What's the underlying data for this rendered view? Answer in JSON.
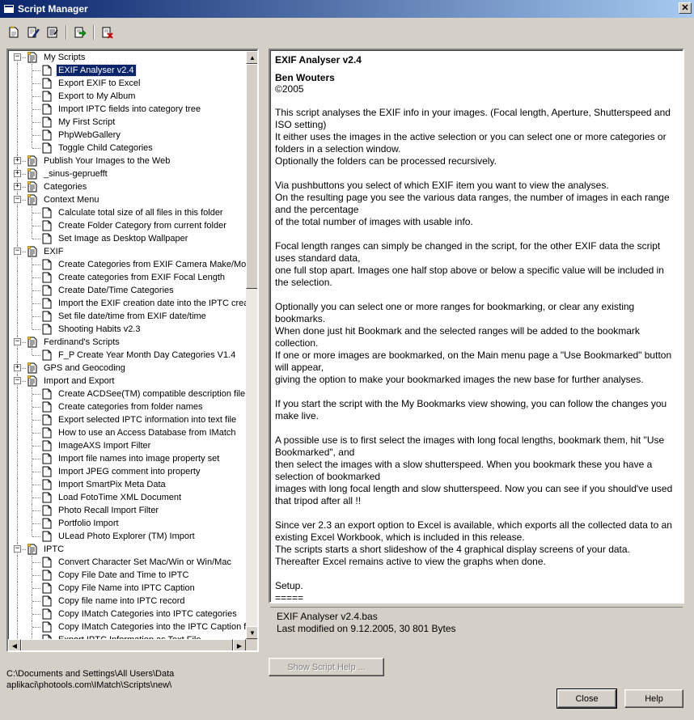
{
  "window": {
    "title": "Script Manager",
    "close_glyph": "✕"
  },
  "toolbar": [
    "new-script-icon",
    "edit-script-icon",
    "properties-icon",
    "run-script-icon",
    "delete-script-icon"
  ],
  "tree": {
    "rows": [
      {
        "label": "My Scripts",
        "level": 0,
        "type": "folder",
        "expander": "−"
      },
      {
        "label": "EXIF Analyser v2.4",
        "level": 1,
        "type": "script",
        "selected": true
      },
      {
        "label": "Export EXIF to Excel",
        "level": 1,
        "type": "script"
      },
      {
        "label": "Export to My Album",
        "level": 1,
        "type": "script"
      },
      {
        "label": "Import IPTC fields into category tree",
        "level": 1,
        "type": "script"
      },
      {
        "label": "My First Script",
        "level": 1,
        "type": "script"
      },
      {
        "label": "PhpWebGallery",
        "level": 1,
        "type": "script"
      },
      {
        "label": "Toggle Child Categories",
        "level": 1,
        "type": "script"
      },
      {
        "label": "Publish Your Images to the Web",
        "level": 0,
        "type": "folder",
        "expander": "+"
      },
      {
        "label": "_sinus-gepruefft",
        "level": 0,
        "type": "folder",
        "expander": "+"
      },
      {
        "label": "Categories",
        "level": 0,
        "type": "folder",
        "expander": "+"
      },
      {
        "label": "Context Menu",
        "level": 0,
        "type": "folder",
        "expander": "−"
      },
      {
        "label": "Calculate total size of all files in this folder",
        "level": 1,
        "type": "script"
      },
      {
        "label": "Create Folder Category from current folder",
        "level": 1,
        "type": "script"
      },
      {
        "label": "Set Image as Desktop Wallpaper",
        "level": 1,
        "type": "script"
      },
      {
        "label": "EXIF",
        "level": 0,
        "type": "folder",
        "expander": "−"
      },
      {
        "label": "Create Categories from EXIF Camera Make/Mod",
        "level": 1,
        "type": "script"
      },
      {
        "label": "Create categories from EXIF Focal Length",
        "level": 1,
        "type": "script"
      },
      {
        "label": "Create Date/Time Categories",
        "level": 1,
        "type": "script"
      },
      {
        "label": "Import the EXIF creation date into the IPTC crea",
        "level": 1,
        "type": "script"
      },
      {
        "label": "Set file date/time from EXIF date/time",
        "level": 1,
        "type": "script"
      },
      {
        "label": "Shooting Habits v2.3",
        "level": 1,
        "type": "script"
      },
      {
        "label": "Ferdinand's Scripts",
        "level": 0,
        "type": "folder",
        "expander": "−"
      },
      {
        "label": "F_P Create Year Month Day Categories V1.4",
        "level": 1,
        "type": "script"
      },
      {
        "label": "GPS and Geocoding",
        "level": 0,
        "type": "folder",
        "expander": "+"
      },
      {
        "label": "Import and Export",
        "level": 0,
        "type": "folder",
        "expander": "−"
      },
      {
        "label": "Create ACDSee(TM) compatible description file f",
        "level": 1,
        "type": "script"
      },
      {
        "label": "Create categories from folder names",
        "level": 1,
        "type": "script"
      },
      {
        "label": "Export selected IPTC information into text file",
        "level": 1,
        "type": "script"
      },
      {
        "label": "How to use an Access Database from IMatch",
        "level": 1,
        "type": "script"
      },
      {
        "label": "ImageAXS Import Filter",
        "level": 1,
        "type": "script"
      },
      {
        "label": "Import file names into image property set",
        "level": 1,
        "type": "script"
      },
      {
        "label": "Import JPEG comment into property",
        "level": 1,
        "type": "script"
      },
      {
        "label": "Import SmartPix Meta Data",
        "level": 1,
        "type": "script"
      },
      {
        "label": "Load FotoTime XML Document",
        "level": 1,
        "type": "script"
      },
      {
        "label": "Photo Recall Import Filter",
        "level": 1,
        "type": "script"
      },
      {
        "label": "Portfolio Import",
        "level": 1,
        "type": "script"
      },
      {
        "label": "ULead Photo Explorer (TM) Import",
        "level": 1,
        "type": "script"
      },
      {
        "label": "IPTC",
        "level": 0,
        "type": "folder",
        "expander": "−"
      },
      {
        "label": "Convert Character Set Mac/Win or Win/Mac",
        "level": 1,
        "type": "script"
      },
      {
        "label": "Copy File Date and Time to IPTC",
        "level": 1,
        "type": "script"
      },
      {
        "label": "Copy File Name into IPTC Caption",
        "level": 1,
        "type": "script"
      },
      {
        "label": "Copy file name into IPTC record",
        "level": 1,
        "type": "script"
      },
      {
        "label": "Copy IMatch Categories into IPTC categories",
        "level": 1,
        "type": "script"
      },
      {
        "label": "Copy IMatch Categories into the IPTC Caption fi",
        "level": 1,
        "type": "script"
      },
      {
        "label": "Export IPTC Information as Text File",
        "level": 1,
        "type": "script"
      }
    ],
    "scroll_up": "▲",
    "scroll_down": "▼",
    "scroll_left": "◀",
    "scroll_right": "▶"
  },
  "description": {
    "title": "EXIF Analyser v2.4",
    "author": "Ben Wouters",
    "year": "©2005",
    "body": "This script analyses the EXIF info in your images. (Focal length, Aperture, Shutterspeed and ISO setting)\nIt either uses the images in the active selection or you can select one or more categories or folders in a selection window.\nOptionally the folders can be processed recursively.\n\nVia pushbuttons you select of which EXIF item you want to view the analyses.\nOn the resulting page you see the various data ranges, the number of images in each range and the percentage\nof the total number of images with usable info.\n\nFocal length ranges can simply be changed in the script, for the other EXIF data the script uses standard data,\none full stop apart. Images one half stop above or below a specific value will be included in the selection.\n\nOptionally you can select one or more ranges for bookmarking, or clear any existing bookmarks.\nWhen done just hit Bookmark and the selected ranges will be added to the bookmark collection.\nIf one or more images are bookmarked, on the Main menu page a \"Use Bookmarked\" button will appear,\ngiving the option to make your bookmarked images the new base for further analyses.\n\nIf you start the script with the My Bookmarks view showing, you can follow the changes you make live.\n\nA possible use is to first select the images with long focal lengths, bookmark them, hit \"Use Bookmarked\", and\nthen select the images with a slow shutterspeed. When you bookmark these you have a selection of bookmarked\nimages with long focal length and slow shutterspeed. Now you can see if you should've used that tripod after all !!\n\nSince ver 2.3 an export option to Excel is available, which exports all the collected data to an existing Excel Workbook, which is included in this release.\nThe scripts starts a short slideshow of the 4 graphical display screens of your data.\nThereafter Excel remains active to view the graphs when done.\n\nSetup.\n=====\n"
  },
  "file_info": {
    "filename": "EXIF Analyser v2.4.bas",
    "modified": "Last modified on 9.12.2005, 30 801 Bytes"
  },
  "buttons": {
    "show_help": "Show Script Help ...",
    "close": "Close",
    "help": "Help"
  },
  "path": {
    "line1": "C:\\Documents and Settings\\All Users\\Data",
    "line2": "aplikaci\\photools.com\\IMatch\\Scripts\\new\\"
  }
}
